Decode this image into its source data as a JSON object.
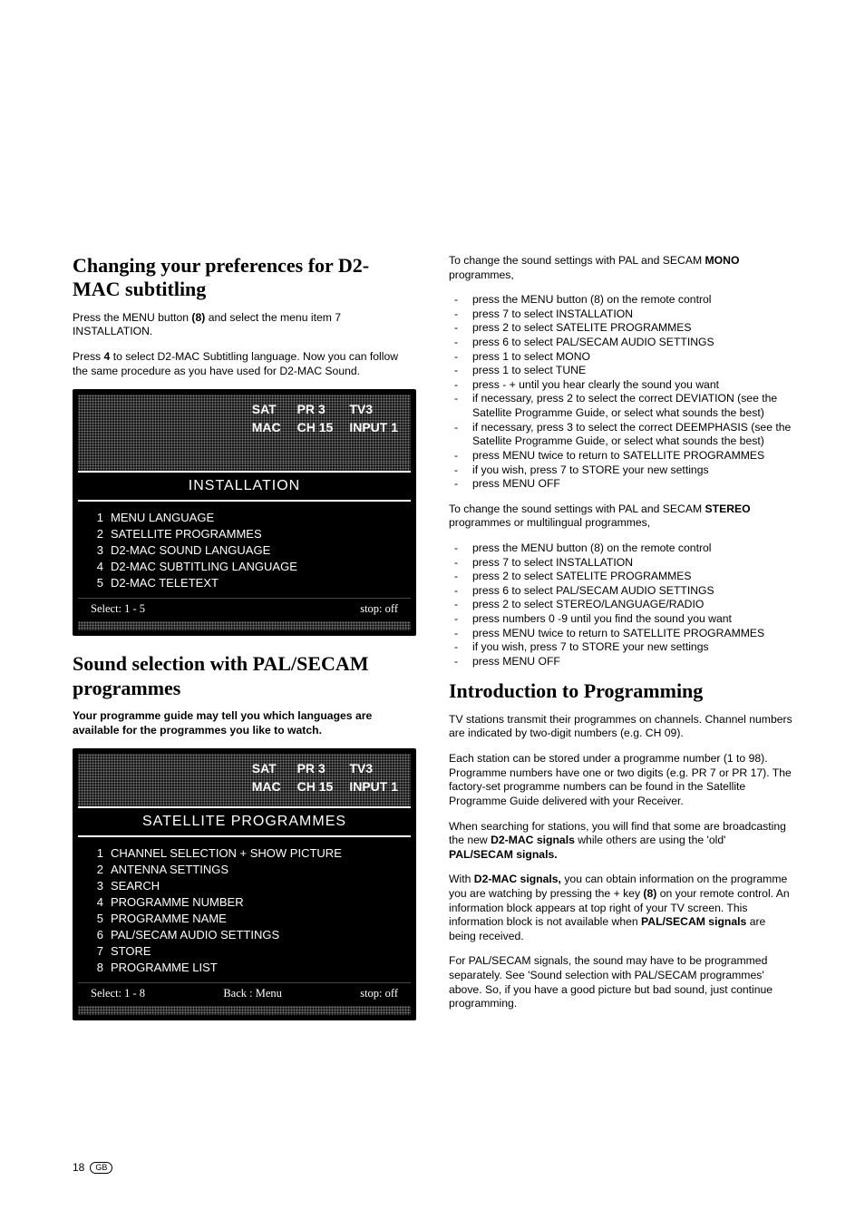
{
  "left": {
    "heading1": "Changing your preferences for D2-MAC subtitling",
    "p1a": "Press the MENU button ",
    "p1b": "(8)",
    "p1c": " and select the menu item 7 INSTALLATION.",
    "p2a": "Press ",
    "p2b": "4",
    "p2c": " to select D2-MAC Subtitling language. Now you can follow the same procedure as you have used for D2-MAC Sound.",
    "osd1": {
      "hdr": {
        "r1c1": "SAT",
        "r1c2": "PR 3",
        "r1c3": "TV3",
        "r2c1": "MAC",
        "r2c2": "CH 15",
        "r2c3": "INPUT 1"
      },
      "title": "INSTALLATION",
      "items": [
        {
          "n": "1",
          "t": "MENU LANGUAGE"
        },
        {
          "n": "2",
          "t": "SATELLITE PROGRAMMES"
        },
        {
          "n": "3",
          "t": "D2-MAC SOUND LANGUAGE"
        },
        {
          "n": "4",
          "t": "D2-MAC SUBTITLING LANGUAGE"
        },
        {
          "n": "5",
          "t": "D2-MAC TELETEXT"
        }
      ],
      "foot_left": "Select: 1 - 5",
      "foot_mid": "",
      "foot_right": "stop: off"
    },
    "heading2": "Sound selection with PAL/SECAM programmes",
    "p3": "Your programme guide may tell you which languages are available for the programmes you like to watch.",
    "osd2": {
      "hdr": {
        "r1c1": "SAT",
        "r1c2": "PR 3",
        "r1c3": "TV3",
        "r2c1": "MAC",
        "r2c2": "CH 15",
        "r2c3": "INPUT 1"
      },
      "title": "SATELLITE PROGRAMMES",
      "items": [
        {
          "n": "1",
          "t": "CHANNEL SELECTION + SHOW PICTURE"
        },
        {
          "n": "2",
          "t": "ANTENNA SETTINGS"
        },
        {
          "n": "3",
          "t": "SEARCH"
        },
        {
          "n": "4",
          "t": "PROGRAMME NUMBER"
        },
        {
          "n": "5",
          "t": "PROGRAMME NAME"
        },
        {
          "n": "6",
          "t": "PAL/SECAM AUDIO SETTINGS"
        },
        {
          "n": "7",
          "t": "STORE"
        },
        {
          "n": "8",
          "t": "PROGRAMME LIST"
        }
      ],
      "foot_left": "Select: 1 - 8",
      "foot_mid": "Back : Menu",
      "foot_right": "stop: off"
    }
  },
  "right": {
    "lead_a": "To change the sound settings with PAL and SECAM ",
    "lead_b": "MONO",
    "lead_c": " programmes,",
    "list1": [
      "press the MENU button (8) on the remote control",
      "press 7 to select INSTALLATION",
      "press 2 to select SATELITE PROGRAMMES",
      "press 6 to select PAL/SECAM AUDIO SETTINGS",
      "press 1 to select MONO",
      "press 1 to select TUNE",
      "press - + until you hear clearly the sound you want",
      "if necessary, press 2 to select the correct DEVIATION (see the Satellite Programme Guide, or select what sounds the best)",
      "if necessary, press 3 to select the correct DEEMPHASIS (see the Satellite Programme Guide, or select what sounds the best)",
      "press MENU twice to return to SATELLITE PROGRAMMES",
      "if you wish, press 7 to STORE your new settings",
      "press MENU OFF"
    ],
    "lead2_a": "To change the sound settings with PAL and SECAM ",
    "lead2_b": "STEREO",
    "lead2_c": " programmes or multilingual programmes,",
    "list2": [
      "press the MENU button (8) on the remote control",
      "press 7 to select INSTALLATION",
      "press 2 to select SATELITE PROGRAMMES",
      "press 6 to select PAL/SECAM AUDIO SETTINGS",
      "press 2 to select STEREO/LANGUAGE/RADIO",
      "press numbers 0 -9 until you find the sound you want",
      "press MENU twice to return to SATELLITE PROGRAMMES",
      "if you wish, press 7 to STORE your new settings",
      "press MENU OFF"
    ],
    "heading3": "Introduction to Programming",
    "p4": "TV stations transmit their programmes on channels. Channel numbers are indicated by two-digit numbers (e.g. CH 09).",
    "p5": "Each station can be stored under a programme number (1 to 98). Programme numbers have one or two digits (e.g. PR 7 or PR 17). The factory-set programme numbers can be found in the Satellite Programme Guide delivered with your Receiver.",
    "p6_a": "When searching for stations, you will find that some are broadcasting the new ",
    "p6_b": "D2-MAC signals",
    "p6_c": " while others are using the 'old' ",
    "p6_d": "PAL/SECAM signals.",
    "p7_a": "With ",
    "p7_b": "D2-MAC signals,",
    "p7_c": " you can obtain information on the programme you are watching by pressing the + key ",
    "p7_d": "(8)",
    "p7_e": " on your remote control. An information block appears at top right of your TV screen. This information block is not available when ",
    "p7_f": "PAL/SECAM signals",
    "p7_g": " are being received.",
    "p8": "For PAL/SECAM signals, the sound may have to be programmed separately. See 'Sound selection with PAL/SECAM programmes' above. So, if you have a good picture but bad sound, just continue programming."
  },
  "pagenum": "18",
  "gb": "GB"
}
